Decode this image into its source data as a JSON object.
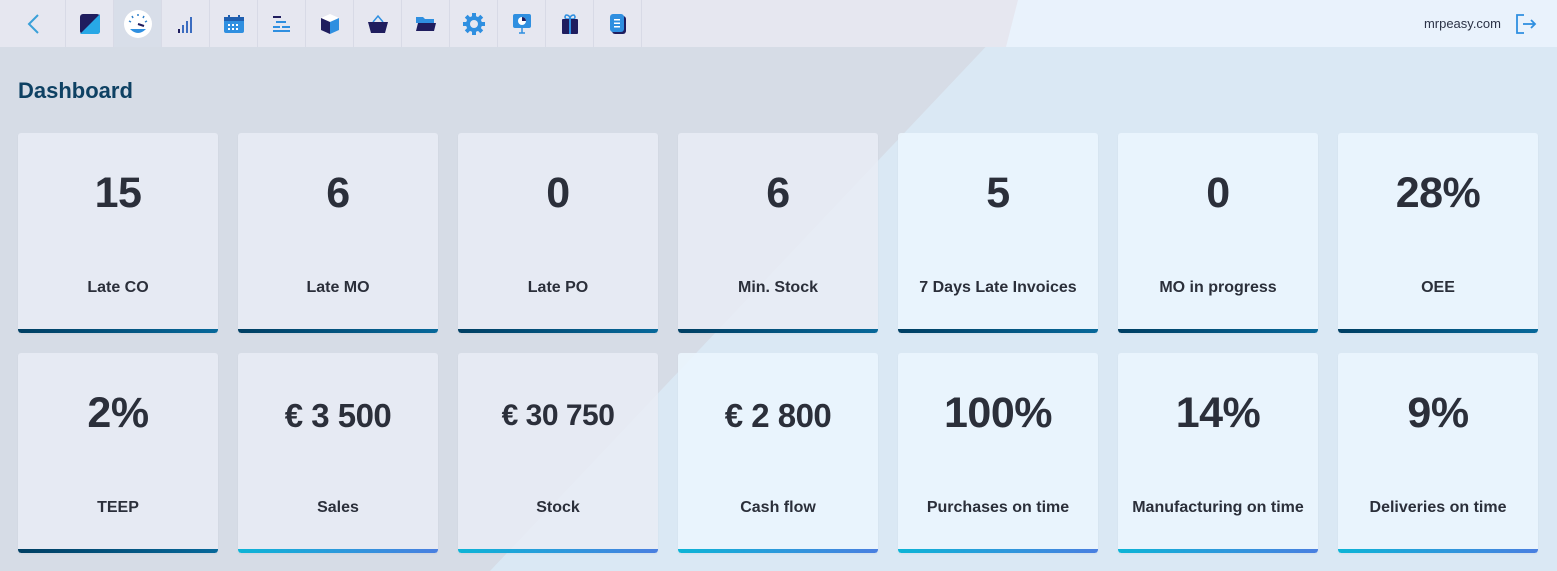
{
  "topbar": {
    "nav": [
      {
        "icon": "back-chevron-icon",
        "name": "back"
      },
      {
        "icon": "app-logo-icon",
        "name": "home"
      },
      {
        "icon": "dashboard-gauge-icon",
        "name": "dashboard",
        "active": true
      },
      {
        "icon": "signal-bars-icon",
        "name": "reports"
      },
      {
        "icon": "calendar-icon",
        "name": "calendar"
      },
      {
        "icon": "gantt-icon",
        "name": "production-planning"
      },
      {
        "icon": "cube-icon",
        "name": "stock"
      },
      {
        "icon": "basket-icon",
        "name": "purchasing"
      },
      {
        "icon": "folder-icon",
        "name": "documents"
      },
      {
        "icon": "gear-icon",
        "name": "settings"
      },
      {
        "icon": "presentation-icon",
        "name": "crm"
      },
      {
        "icon": "gift-icon",
        "name": "products"
      },
      {
        "icon": "document-icon",
        "name": "invoices"
      }
    ],
    "site": "mrpeasy.com",
    "logout_icon": "logout-icon"
  },
  "page": {
    "title": "Dashboard"
  },
  "colors": {
    "bar_dark": "#003f63",
    "bar_cyan": "#0db4d6",
    "title": "#0e4163"
  },
  "cards": [
    {
      "value": "15",
      "label": "Late CO",
      "bar": "dark"
    },
    {
      "value": "6",
      "label": "Late MO",
      "bar": "dark"
    },
    {
      "value": "0",
      "label": "Late PO",
      "bar": "dark"
    },
    {
      "value": "6",
      "label": "Min. Stock",
      "bar": "dark"
    },
    {
      "value": "5",
      "label": "7 Days Late Invoices",
      "bar": "dark"
    },
    {
      "value": "0",
      "label": "MO in progress",
      "bar": "dark"
    },
    {
      "value": "28%",
      "label": "OEE",
      "bar": "dark"
    },
    {
      "value": "2%",
      "label": "TEEP",
      "bar": "dark"
    },
    {
      "value": "€ 3 500",
      "label": "Sales",
      "bar": "cyan"
    },
    {
      "value": "€ 30 750",
      "label": "Stock",
      "bar": "cyan"
    },
    {
      "value": "€ 2 800",
      "label": "Cash flow",
      "bar": "cyan"
    },
    {
      "value": "100%",
      "label": "Purchases on time",
      "bar": "cyan"
    },
    {
      "value": "14%",
      "label": "Manufacturing on time",
      "bar": "cyan"
    },
    {
      "value": "9%",
      "label": "Deliveries on time",
      "bar": "cyan"
    }
  ]
}
